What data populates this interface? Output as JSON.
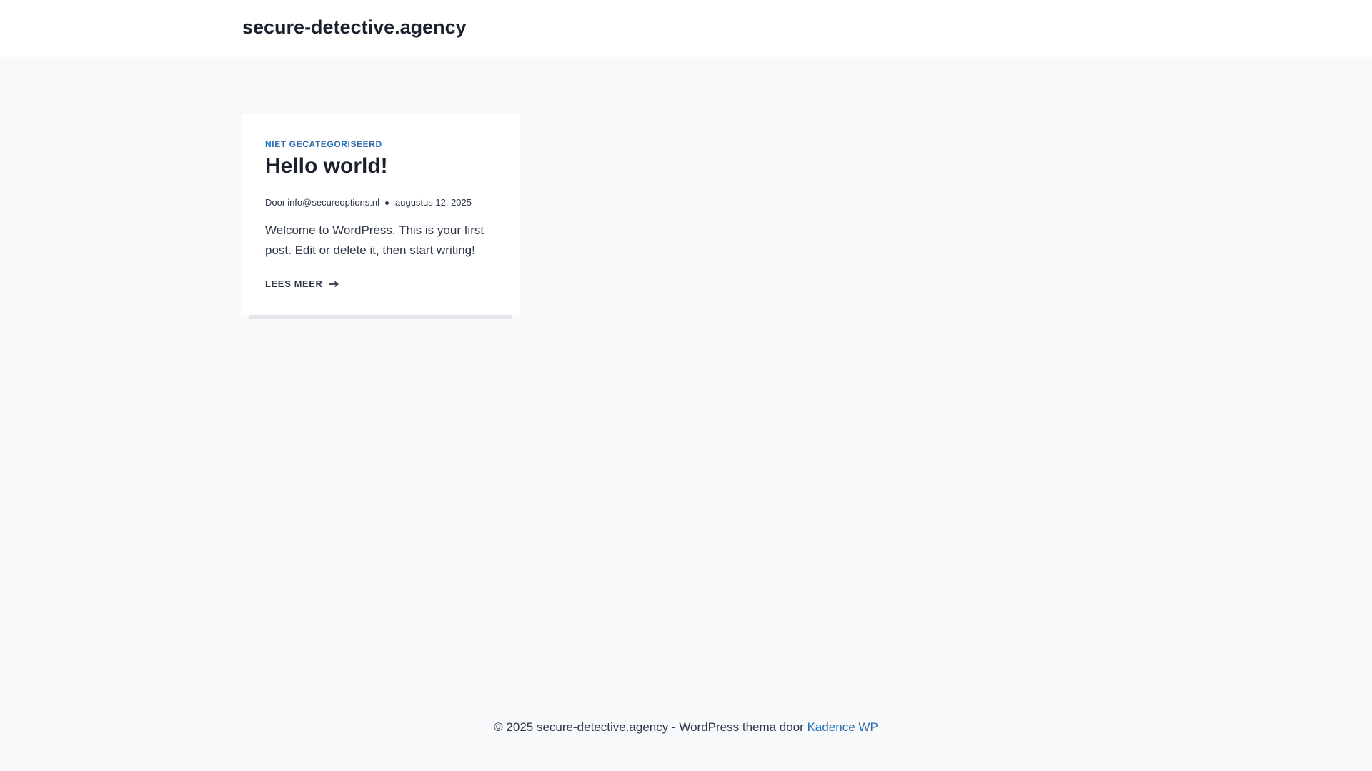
{
  "header": {
    "site_title": "secure-detective.agency"
  },
  "post": {
    "category": "NIET GECATEGORISEERD",
    "title": "Hello world!",
    "author_prefix": "Door",
    "author": "info@secureoptions.nl",
    "date": "augustus 12, 2025",
    "excerpt": "Welcome to WordPress. This is your first post. Edit or delete it, then start writing!",
    "read_more": "LEES MEER",
    "read_more_icon": "arrow-right-icon"
  },
  "footer": {
    "copyright": "© 2025 secure-detective.agency - WordPress thema door",
    "link_text": "Kadence WP"
  },
  "colors": {
    "background": "#f7f9fb",
    "card": "#ffffff",
    "accent": "#2b6cb0",
    "text": "#1a202c"
  }
}
